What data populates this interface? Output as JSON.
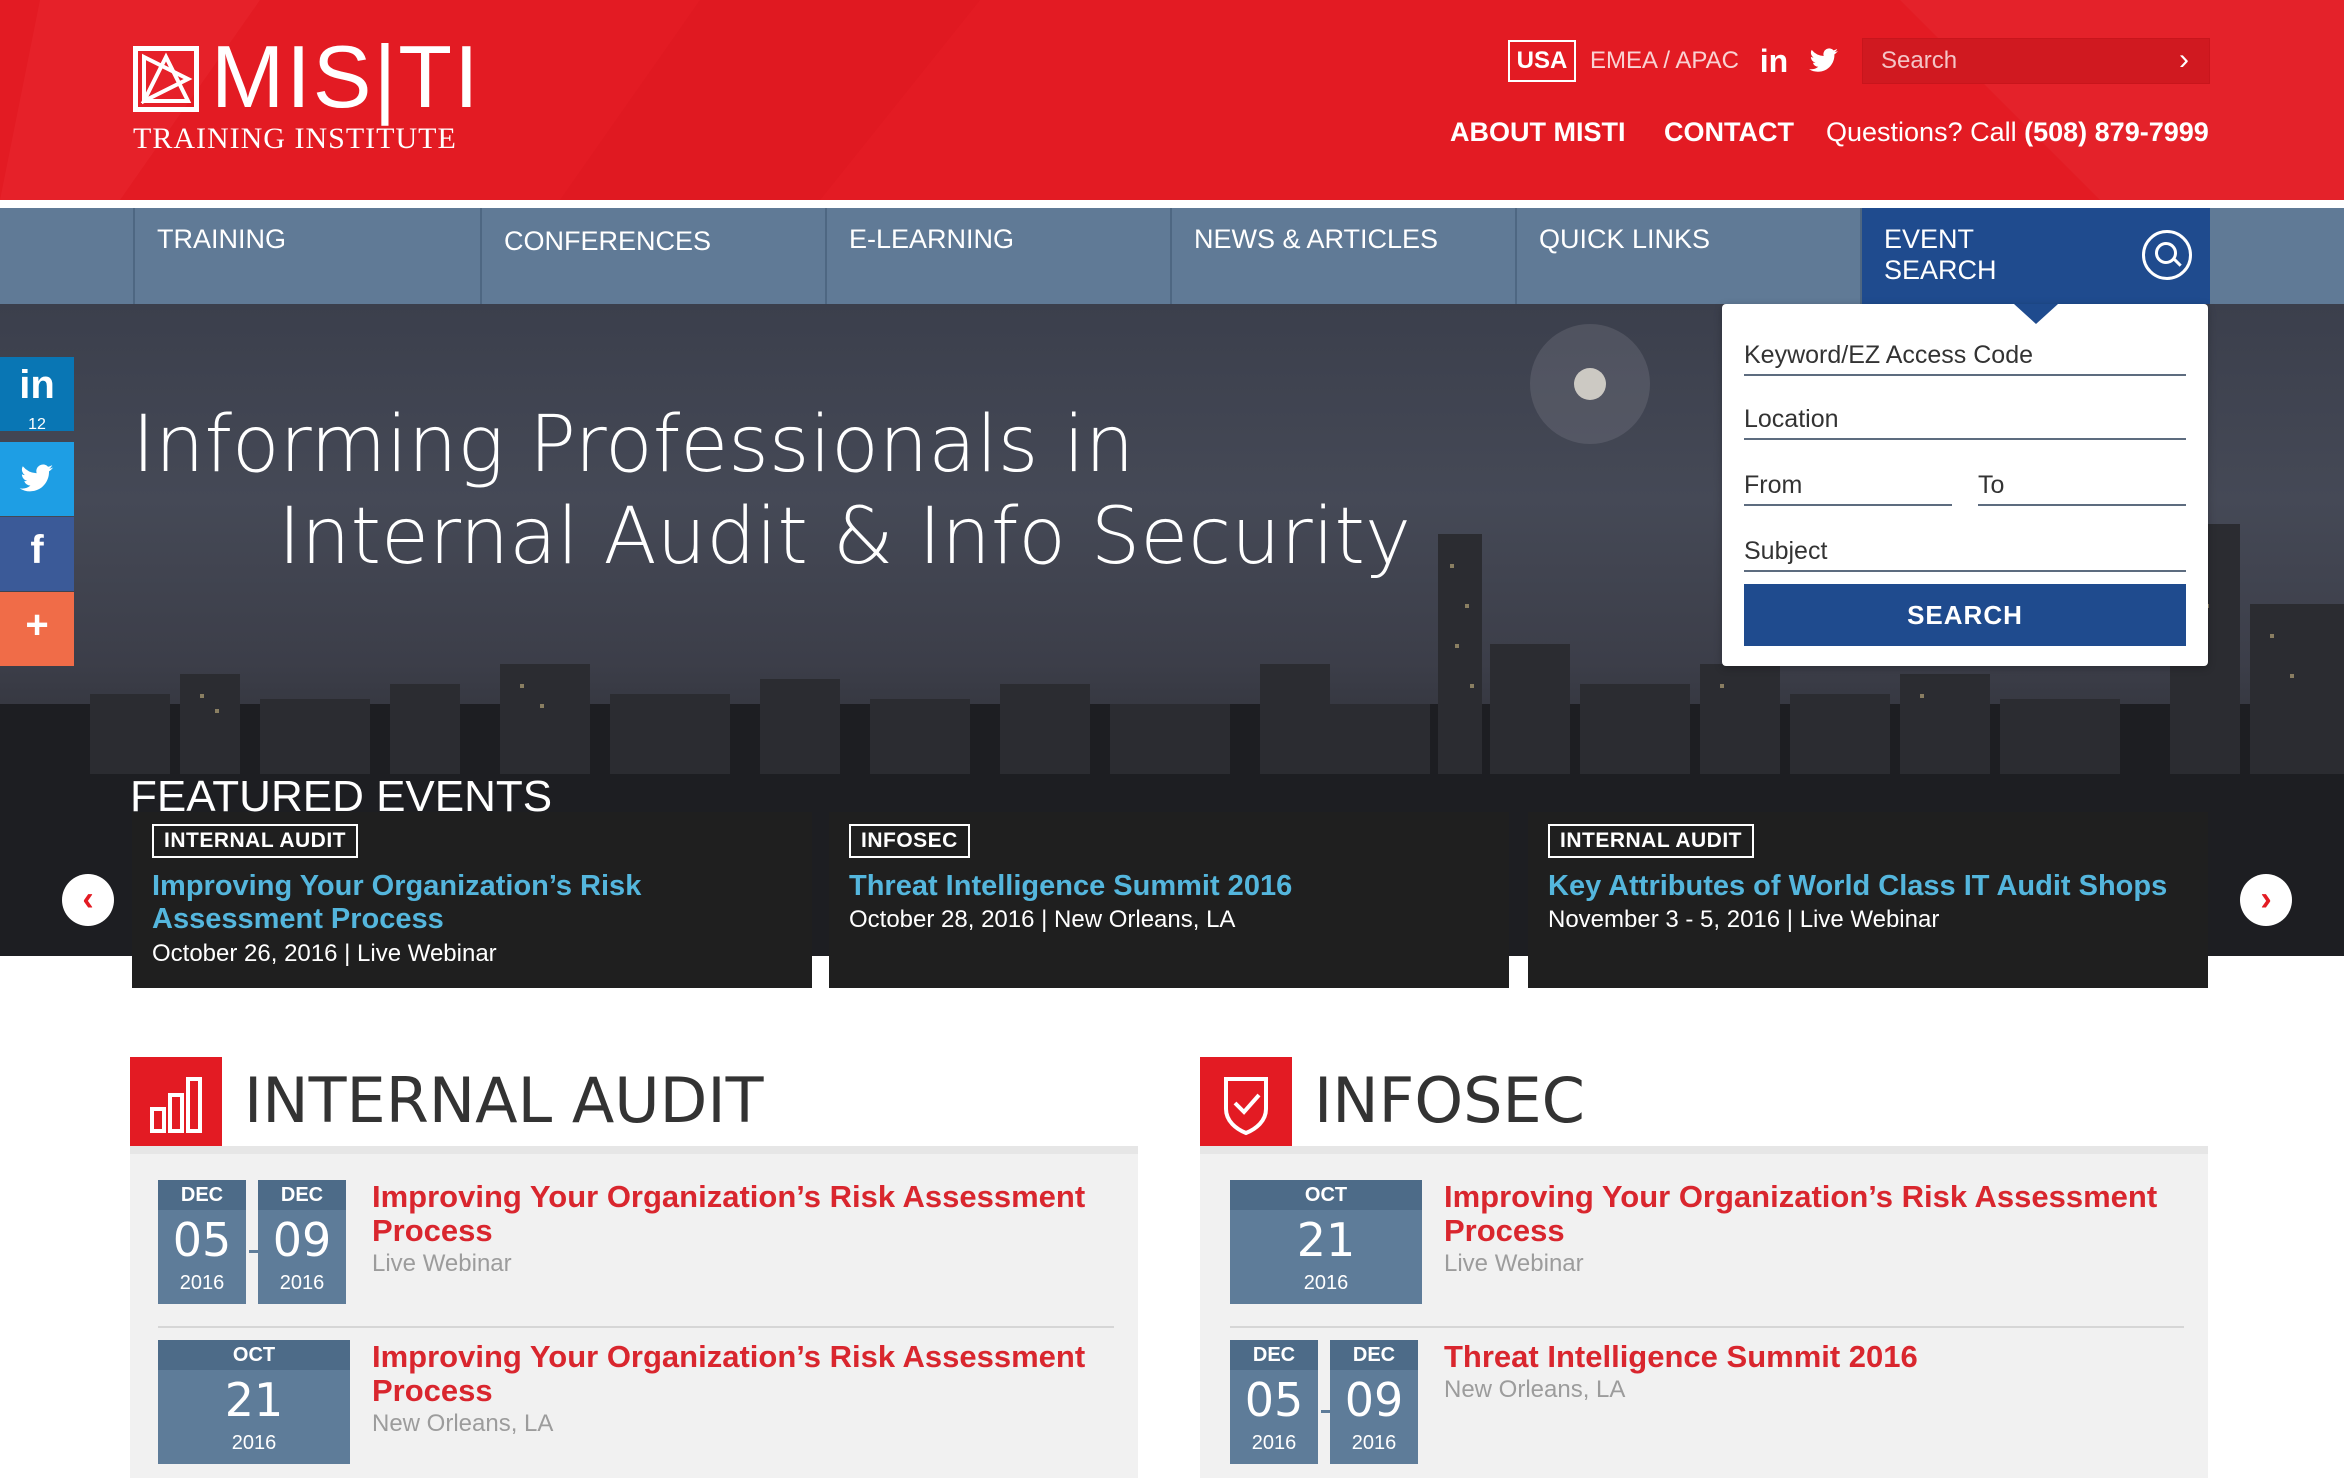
{
  "header": {
    "logo_text": "MIS|TI",
    "logo_sub": "TRAINING INSTITUTE",
    "region_active": "USA",
    "region_other": "EMEA / APAC",
    "social": [
      {
        "icon": "linkedin-icon",
        "glyph": "in"
      },
      {
        "icon": "twitter-icon",
        "glyph": "🐦"
      }
    ],
    "search_placeholder": "Search",
    "search_go": "›",
    "about": "ABOUT MISTI",
    "contact": "CONTACT",
    "call_label": "Questions? Call",
    "call_number": "(508) 879-7999",
    "brand_color": "#e31b23"
  },
  "nav": {
    "items": [
      {
        "label": "TRAINING"
      },
      {
        "label": "CONFERENCES"
      },
      {
        "label": "E-LEARNING"
      },
      {
        "label": "NEWS & ARTICLES"
      },
      {
        "label": "QUICK LINKS"
      }
    ],
    "event_search_1": "EVENT",
    "event_search_2": "SEARCH",
    "nav_color": "#607a96",
    "active_color": "#1f4b8e"
  },
  "share": {
    "linkedin_count": "12"
  },
  "event_search": {
    "keyword": "Keyword/EZ Access Code",
    "location": "Location",
    "from": "From",
    "to": "To",
    "subject": "Subject",
    "button": "SEARCH"
  },
  "hero": {
    "line1": "Informing Professionals in",
    "line2": "Internal Audit & Info Security",
    "featured": "FEATURED EVENTS",
    "prev": "‹",
    "next": "›"
  },
  "featured_events": [
    {
      "tag": "INTERNAL AUDIT",
      "title": "Improving Your Organization’s Risk Assessment Process",
      "meta": "October 26, 2016  |  Live Webinar"
    },
    {
      "tag": "INFOSEC",
      "title": "Threat Intelligence Summit 2016",
      "meta": "October 28, 2016  |  New Orleans, LA"
    },
    {
      "tag": "INTERNAL AUDIT",
      "title": "Key Attributes of World Class IT Audit Shops",
      "meta": "November 3 - 5, 2016  |  Live Webinar"
    }
  ],
  "internal_audit": {
    "title": "INTERNAL AUDIT",
    "events": [
      {
        "start_mon": "DEC",
        "start_day": "05",
        "start_yr": "2016",
        "end_mon": "DEC",
        "end_day": "09",
        "end_yr": "2016",
        "title": "Improving Your Organization’s Risk Assessment Process",
        "sub": "Live Webinar"
      },
      {
        "mon": "OCT",
        "day": "21",
        "yr": "2016",
        "title": "Improving Your Organization’s Risk Assessment Process",
        "sub": "New Orleans, LA"
      }
    ]
  },
  "infosec": {
    "title": "INFOSEC",
    "events": [
      {
        "mon": "OCT",
        "day": "21",
        "yr": "2016",
        "title": "Improving Your Organization’s Risk Assessment Process",
        "sub": "Live Webinar"
      },
      {
        "start_mon": "DEC",
        "start_day": "05",
        "start_yr": "2016",
        "end_mon": "DEC",
        "end_day": "09",
        "end_yr": "2016",
        "title": "Threat Intelligence Summit 2016",
        "sub": "New Orleans, LA"
      }
    ]
  }
}
